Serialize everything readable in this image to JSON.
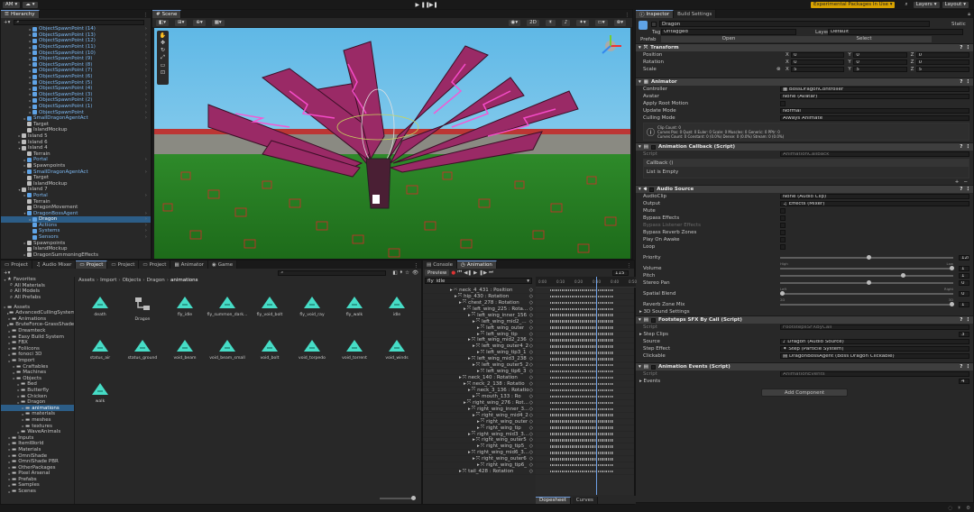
{
  "topbar": {
    "account": "AM",
    "cloud_icon": "cloud-icon",
    "play_buttons": [
      "▶",
      "❚❚",
      "▶❚"
    ],
    "experimental": "Experimental Packages In Use",
    "layers": "Layers",
    "layout": "Layout"
  },
  "hierarchy": {
    "tab": "Hierarchy",
    "items": [
      {
        "label": "ObjectSpawnPoint (14)",
        "indent": 5,
        "style": "blue",
        "exp": "▸"
      },
      {
        "label": "ObjectSpawnPoint (13)",
        "indent": 5,
        "style": "blue",
        "exp": "▸"
      },
      {
        "label": "ObjectSpawnPoint (12)",
        "indent": 5,
        "style": "blue",
        "exp": "▸"
      },
      {
        "label": "ObjectSpawnPoint (11)",
        "indent": 5,
        "style": "blue",
        "exp": "▸"
      },
      {
        "label": "ObjectSpawnPoint (10)",
        "indent": 5,
        "style": "blue",
        "exp": "▸"
      },
      {
        "label": "ObjectSpawnPoint (9)",
        "indent": 5,
        "style": "blue",
        "exp": "▸"
      },
      {
        "label": "ObjectSpawnPoint (8)",
        "indent": 5,
        "style": "blue",
        "exp": "▸"
      },
      {
        "label": "ObjectSpawnPoint (7)",
        "indent": 5,
        "style": "blue",
        "exp": "▸"
      },
      {
        "label": "ObjectSpawnPoint (6)",
        "indent": 5,
        "style": "blue",
        "exp": "▸"
      },
      {
        "label": "ObjectSpawnPoint (5)",
        "indent": 5,
        "style": "blue",
        "exp": "▸"
      },
      {
        "label": "ObjectSpawnPoint (4)",
        "indent": 5,
        "style": "blue",
        "exp": "▸"
      },
      {
        "label": "ObjectSpawnPoint (3)",
        "indent": 5,
        "style": "blue",
        "exp": "▸"
      },
      {
        "label": "ObjectSpawnPoint (2)",
        "indent": 5,
        "style": "blue",
        "exp": "▸"
      },
      {
        "label": "ObjectSpawnPoint (1)",
        "indent": 5,
        "style": "blue",
        "exp": "▸"
      },
      {
        "label": "ObjectSpawnPoint",
        "indent": 5,
        "style": "blue",
        "exp": "▸"
      },
      {
        "label": "SmallDragonAgentAct",
        "indent": 4,
        "style": "blue",
        "exp": "▸"
      },
      {
        "label": "Target",
        "indent": 4,
        "style": "grey",
        "exp": ""
      },
      {
        "label": "IslandMockup",
        "indent": 4,
        "style": "grey",
        "exp": ""
      },
      {
        "label": "Island 5",
        "indent": 3,
        "style": "grey",
        "exp": "▸"
      },
      {
        "label": "Island 6",
        "indent": 3,
        "style": "grey",
        "exp": "▸"
      },
      {
        "label": "Island 4",
        "indent": 3,
        "style": "grey",
        "exp": "▾"
      },
      {
        "label": "Terrain",
        "indent": 4,
        "style": "grey",
        "exp": ""
      },
      {
        "label": "Portal",
        "indent": 4,
        "style": "blue",
        "exp": "▸"
      },
      {
        "label": "Spawnpoints",
        "indent": 4,
        "style": "grey",
        "exp": "▸"
      },
      {
        "label": "SmallDragonAgentAct",
        "indent": 4,
        "style": "blue",
        "exp": "▸"
      },
      {
        "label": "Target",
        "indent": 4,
        "style": "grey",
        "exp": ""
      },
      {
        "label": "IslandMockup",
        "indent": 4,
        "style": "grey",
        "exp": ""
      },
      {
        "label": "Island 7",
        "indent": 3,
        "style": "grey",
        "exp": "▾"
      },
      {
        "label": "Portal",
        "indent": 4,
        "style": "blue",
        "exp": "▸"
      },
      {
        "label": "Terrain",
        "indent": 4,
        "style": "grey",
        "exp": ""
      },
      {
        "label": "DragonMovement",
        "indent": 4,
        "style": "grey",
        "exp": ""
      },
      {
        "label": "DragonBossAgent",
        "indent": 4,
        "style": "blue",
        "exp": "▾"
      },
      {
        "label": "Dragon",
        "indent": 5,
        "style": "selected",
        "exp": "▸"
      },
      {
        "label": "Actions",
        "indent": 5,
        "style": "blue",
        "exp": ""
      },
      {
        "label": "Systems",
        "indent": 5,
        "style": "blue",
        "exp": ""
      },
      {
        "label": "Sensors",
        "indent": 5,
        "style": "blue",
        "exp": ""
      },
      {
        "label": "Spawnpoints",
        "indent": 4,
        "style": "grey",
        "exp": "▸"
      },
      {
        "label": "IslandMockup",
        "indent": 4,
        "style": "grey",
        "exp": ""
      },
      {
        "label": "DragonSummoningEffects",
        "indent": 4,
        "style": "grey",
        "exp": "▸"
      }
    ]
  },
  "scene": {
    "tab": "Scene",
    "toolbar_label": "2D"
  },
  "inspector": {
    "tabs": [
      "Inspector",
      "Build Settings"
    ],
    "object_name": "Dragon",
    "static_label": "Static",
    "tag_label": "Tag",
    "tag_value": "Untagged",
    "layer_label": "Layer",
    "layer_value": "Default",
    "prefab_label": "Prefab",
    "open_label": "Open",
    "select_label": "Select",
    "transform": {
      "title": "Transform",
      "rows": [
        {
          "label": "Position",
          "x": "0",
          "y": "0",
          "z": "0",
          "link": ""
        },
        {
          "label": "Rotation",
          "x": "0",
          "y": "0",
          "z": "0",
          "link": ""
        },
        {
          "label": "Scale",
          "x": "5",
          "y": "5",
          "z": "5",
          "link": "⊗"
        }
      ]
    },
    "animator": {
      "title": "Animator",
      "controller_label": "Controller",
      "controller_value": "BossDragonController",
      "avatar_label": "Avatar",
      "avatar_value": "None (Avatar)",
      "apply_root_label": "Apply Root Motion",
      "update_mode_label": "Update Mode",
      "update_mode_value": "Normal",
      "culling_label": "Culling Mode",
      "culling_value": "Always Animate",
      "info_line1": "Clip Count: 0",
      "info_line2": "Curves Pos: 0 Quat: 0 Euler: 0 Scale: 0 Muscles: 0 Generic: 0 PPtr: 0",
      "info_line3": "Curves Count: 0 Constant: 0 (0.0%) Dense: 0 (0.0%) Stream: 0 (0.0%)"
    },
    "anim_callback": {
      "title": "Animation Callback (Script)",
      "script_label": "Script",
      "script_value": "AnimationCallback",
      "callback_label": "Callback ()",
      "list_empty": "List is Empty",
      "plus": "+",
      "minus": "−"
    },
    "audio": {
      "title": "Audio Source",
      "fields": [
        {
          "label": "AudioClip",
          "value": "None (Audio Clip)"
        },
        {
          "label": "Output",
          "value": "Effects (Mixer)"
        }
      ],
      "checks": [
        "Mute",
        "Bypass Effects",
        "Bypass Listener Effects",
        "Bypass Reverb Zones",
        "Play On Awake",
        "Loop"
      ],
      "priority_label": "Priority",
      "priority_value": "128",
      "priority_level": 0.5,
      "priority_high": "High",
      "priority_low": "Low",
      "volume_label": "Volume",
      "volume_value": "1",
      "pitch_label": "Pitch",
      "pitch_value": "1",
      "pitch_level": 0.7,
      "stereo_label": "Stereo Pan",
      "stereo_value": "0",
      "stereo_left": "Left",
      "stereo_right": "Right",
      "spatial_label": "Spatial Blend",
      "spatial_value": "0",
      "spatial_2d": "2D",
      "spatial_3d": "3D",
      "reverb_label": "Reverb Zone Mix",
      "reverb_value": "1",
      "sound3d_label": "3D Sound Settings"
    },
    "footsteps": {
      "title": "Footsteps SFX By Call (Script)",
      "script_label": "Script",
      "script_value": "FootstepsSFXByCall",
      "step_clips_label": "Step Clips",
      "step_clips_count": "3",
      "source_label": "Source",
      "source_value": "Dragon (Audio Source)",
      "step_effect_label": "Step Effect",
      "step_effect_value": "Step (Particle System)",
      "clickable_label": "Clickable",
      "clickable_value": "DragonBossAgent (Boss Dragon Clickable)"
    },
    "anim_events": {
      "title": "Animation Events (Script)",
      "script_label": "Script",
      "script_value": "AnimationEvents",
      "events_label": "Events",
      "events_count": "4"
    },
    "add_component": "Add Component"
  },
  "project": {
    "tabs": [
      "Project",
      "Audio Mixer",
      "Project",
      "Project",
      "Project",
      "Animator",
      "Game"
    ],
    "breadcrumb": [
      "Assets",
      "Import",
      "Objects",
      "Dragon",
      "animations"
    ],
    "favorites_label": "Favorites",
    "favorites": [
      "All Materials",
      "All Models",
      "All Prefabs"
    ],
    "folders": [
      {
        "label": "Assets",
        "indent": 0
      },
      {
        "label": "AdvancedCullingSystem",
        "indent": 1
      },
      {
        "label": "Animations",
        "indent": 1
      },
      {
        "label": "BruteForce-GrassShader",
        "indent": 1
      },
      {
        "label": "Dreamteck",
        "indent": 1
      },
      {
        "label": "Easy Build System",
        "indent": 1
      },
      {
        "label": "FBX",
        "indent": 1
      },
      {
        "label": "Foliicons",
        "indent": 1
      },
      {
        "label": "fonoci 3D",
        "indent": 1
      },
      {
        "label": "Import",
        "indent": 1
      },
      {
        "label": "Craftables",
        "indent": 2
      },
      {
        "label": "Machines",
        "indent": 2
      },
      {
        "label": "Objects",
        "indent": 2
      },
      {
        "label": "Bed",
        "indent": 3
      },
      {
        "label": "Butterfly",
        "indent": 3
      },
      {
        "label": "Chicken",
        "indent": 3
      },
      {
        "label": "Dragon",
        "indent": 3
      },
      {
        "label": "animations",
        "indent": 4
      },
      {
        "label": "materials",
        "indent": 4
      },
      {
        "label": "meshes",
        "indent": 4
      },
      {
        "label": "textures",
        "indent": 4
      },
      {
        "label": "WaveAnimals",
        "indent": 3
      },
      {
        "label": "Inputs",
        "indent": 1
      },
      {
        "label": "ItemWorld",
        "indent": 1
      },
      {
        "label": "Materials",
        "indent": 1
      },
      {
        "label": "OmniShade",
        "indent": 1
      },
      {
        "label": "OmniShade PBR",
        "indent": 1
      },
      {
        "label": "OtherPackages",
        "indent": 1
      },
      {
        "label": "Pixel Arsenal",
        "indent": 1
      },
      {
        "label": "Prefabs",
        "indent": 1
      },
      {
        "label": "Samples",
        "indent": 1
      },
      {
        "label": "Scenes",
        "indent": 1
      }
    ],
    "assets": [
      {
        "name": "death",
        "kind": "anim"
      },
      {
        "name": "Dragon",
        "kind": "controller"
      },
      {
        "name": "fly_idle",
        "kind": "anim"
      },
      {
        "name": "fly_summon_dark...",
        "kind": "anim"
      },
      {
        "name": "fly_void_bolt",
        "kind": "anim"
      },
      {
        "name": "fly_void_ray",
        "kind": "anim"
      },
      {
        "name": "fly_walk",
        "kind": "anim"
      },
      {
        "name": "idle",
        "kind": "anim"
      },
      {
        "name": "status_air",
        "kind": "anim"
      },
      {
        "name": "status_ground",
        "kind": "anim"
      },
      {
        "name": "void_beam",
        "kind": "anim"
      },
      {
        "name": "void_beam_small",
        "kind": "anim"
      },
      {
        "name": "void_bolt",
        "kind": "anim"
      },
      {
        "name": "void_torpedo",
        "kind": "anim"
      },
      {
        "name": "void_torrent",
        "kind": "anim"
      },
      {
        "name": "void_winds",
        "kind": "anim"
      },
      {
        "name": "walk",
        "kind": "anim"
      }
    ]
  },
  "animation": {
    "tabs": [
      "Console",
      "Animation"
    ],
    "preview_label": "Preview",
    "clip": "fly_idle",
    "frame": "115",
    "dopesheet": "Dopesheet",
    "curves": "Curves",
    "timeline": [
      "0:00",
      "0:10",
      "0:20",
      "0:30",
      "0:40",
      "0:50"
    ],
    "playhead_frac": 0.6,
    "props": [
      {
        "label": "neck_4_431 : Position",
        "indent": 0
      },
      {
        "label": "hip_430 : Rotation",
        "indent": 1
      },
      {
        "label": "chest_278 : Rotation",
        "indent": 2
      },
      {
        "label": "left_wing_225 : Rotation",
        "indent": 3
      },
      {
        "label": "left_wing_inner_156",
        "indent": 4
      },
      {
        "label": "left_wing_mid2_186",
        "indent": 5
      },
      {
        "label": "left_wing_outer",
        "indent": 6
      },
      {
        "label": "left_wing_tip",
        "indent": 6
      },
      {
        "label": "left_wing_mid2_236",
        "indent": 4
      },
      {
        "label": "left_wing_outer4_2",
        "indent": 5
      },
      {
        "label": "left_wing_tip3_1",
        "indent": 6
      },
      {
        "label": "left_wing_mid3_238",
        "indent": 4
      },
      {
        "label": "left_wing_outer5_2",
        "indent": 5
      },
      {
        "label": "left_wing_tip6_3",
        "indent": 6
      },
      {
        "label": "neck_140 : Rotation",
        "indent": 2
      },
      {
        "label": "neck_2_138 : Rotatio",
        "indent": 3
      },
      {
        "label": "neck_3_136 : Rotatio",
        "indent": 4
      },
      {
        "label": "mouth_133 : Ro",
        "indent": 5
      },
      {
        "label": "right_wing_276 : Rotation",
        "indent": 3
      },
      {
        "label": "right_wing_inner_363",
        "indent": 4
      },
      {
        "label": "right_wing_mid4_2",
        "indent": 5
      },
      {
        "label": "right_wing_outer",
        "indent": 6
      },
      {
        "label": "right_wing_tip",
        "indent": 6
      },
      {
        "label": "right_wing_mid3_363",
        "indent": 4
      },
      {
        "label": "right_wing_outer5",
        "indent": 5
      },
      {
        "label": "right_wing_tip5_",
        "indent": 6
      },
      {
        "label": "right_wing_mid6_376",
        "indent": 4
      },
      {
        "label": "right_wing_outer6",
        "indent": 5
      },
      {
        "label": "right_wing_tip6_",
        "indent": 6
      },
      {
        "label": "tail_428 : Rotation",
        "indent": 2
      }
    ]
  },
  "colors": {
    "accent": "#2c5d87",
    "link_blue": "#7cb7f0",
    "warning": "#d8a200",
    "anim_icon": "#46dcc6"
  }
}
